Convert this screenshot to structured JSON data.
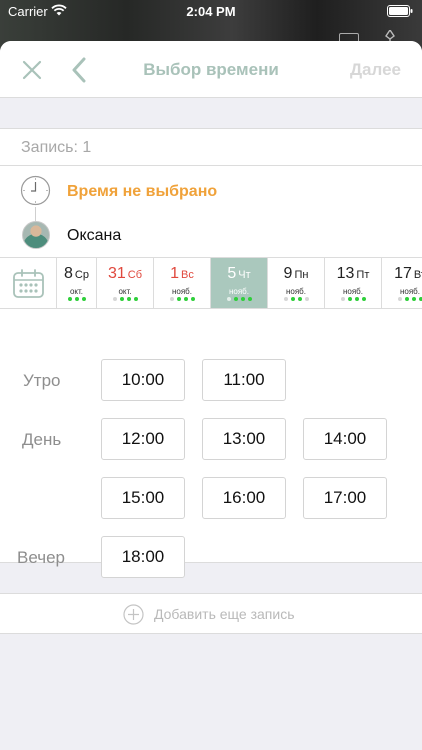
{
  "status_bar": {
    "carrier": "Carrier",
    "time": "2:04 PM"
  },
  "nav": {
    "title": "Выбор времени",
    "next_label": "Далее"
  },
  "entry": {
    "label": "Запись: 1"
  },
  "info": {
    "time_status": "Время не выбрано",
    "master_name": "Оксана"
  },
  "date_strip": {
    "days": [
      {
        "num": "8",
        "weekday": "Ср",
        "month": "окт.",
        "dots": [
          1,
          1,
          1
        ],
        "weekend": false,
        "selected": false
      },
      {
        "num": "31",
        "weekday": "Сб",
        "month": "окт.",
        "dots": [
          0,
          1,
          1,
          1
        ],
        "weekend": true,
        "selected": false
      },
      {
        "num": "1",
        "weekday": "Вс",
        "month": "нояб.",
        "dots": [
          0,
          1,
          1,
          1
        ],
        "weekend": true,
        "selected": false
      },
      {
        "num": "5",
        "weekday": "Чт",
        "month": "нояб.",
        "dots": [
          0,
          1,
          1,
          1
        ],
        "weekend": false,
        "selected": true
      },
      {
        "num": "9",
        "weekday": "Пн",
        "month": "нояб.",
        "dots": [
          0,
          1,
          1,
          0
        ],
        "weekend": false,
        "selected": false
      },
      {
        "num": "13",
        "weekday": "Пт",
        "month": "нояб.",
        "dots": [
          0,
          1,
          1,
          1
        ],
        "weekend": false,
        "selected": false
      },
      {
        "num": "17",
        "weekday": "Вт",
        "month": "нояб.",
        "dots": [
          0,
          1,
          1,
          1
        ],
        "weekend": false,
        "selected": false
      }
    ]
  },
  "slots": {
    "morning": {
      "label": "Утро",
      "times": [
        "10:00",
        "11:00"
      ]
    },
    "day": {
      "label": "День",
      "times": [
        "12:00",
        "13:00",
        "14:00",
        "15:00",
        "16:00",
        "17:00"
      ]
    },
    "evening": {
      "label": "Вечер",
      "times": [
        "18:00"
      ]
    }
  },
  "add_entry": {
    "label": "Добавить еще запись"
  },
  "colors": {
    "accent": "#aac8bd",
    "warning": "#f0a23a",
    "weekend": "#e0483d",
    "available": "#2fcf3a"
  }
}
